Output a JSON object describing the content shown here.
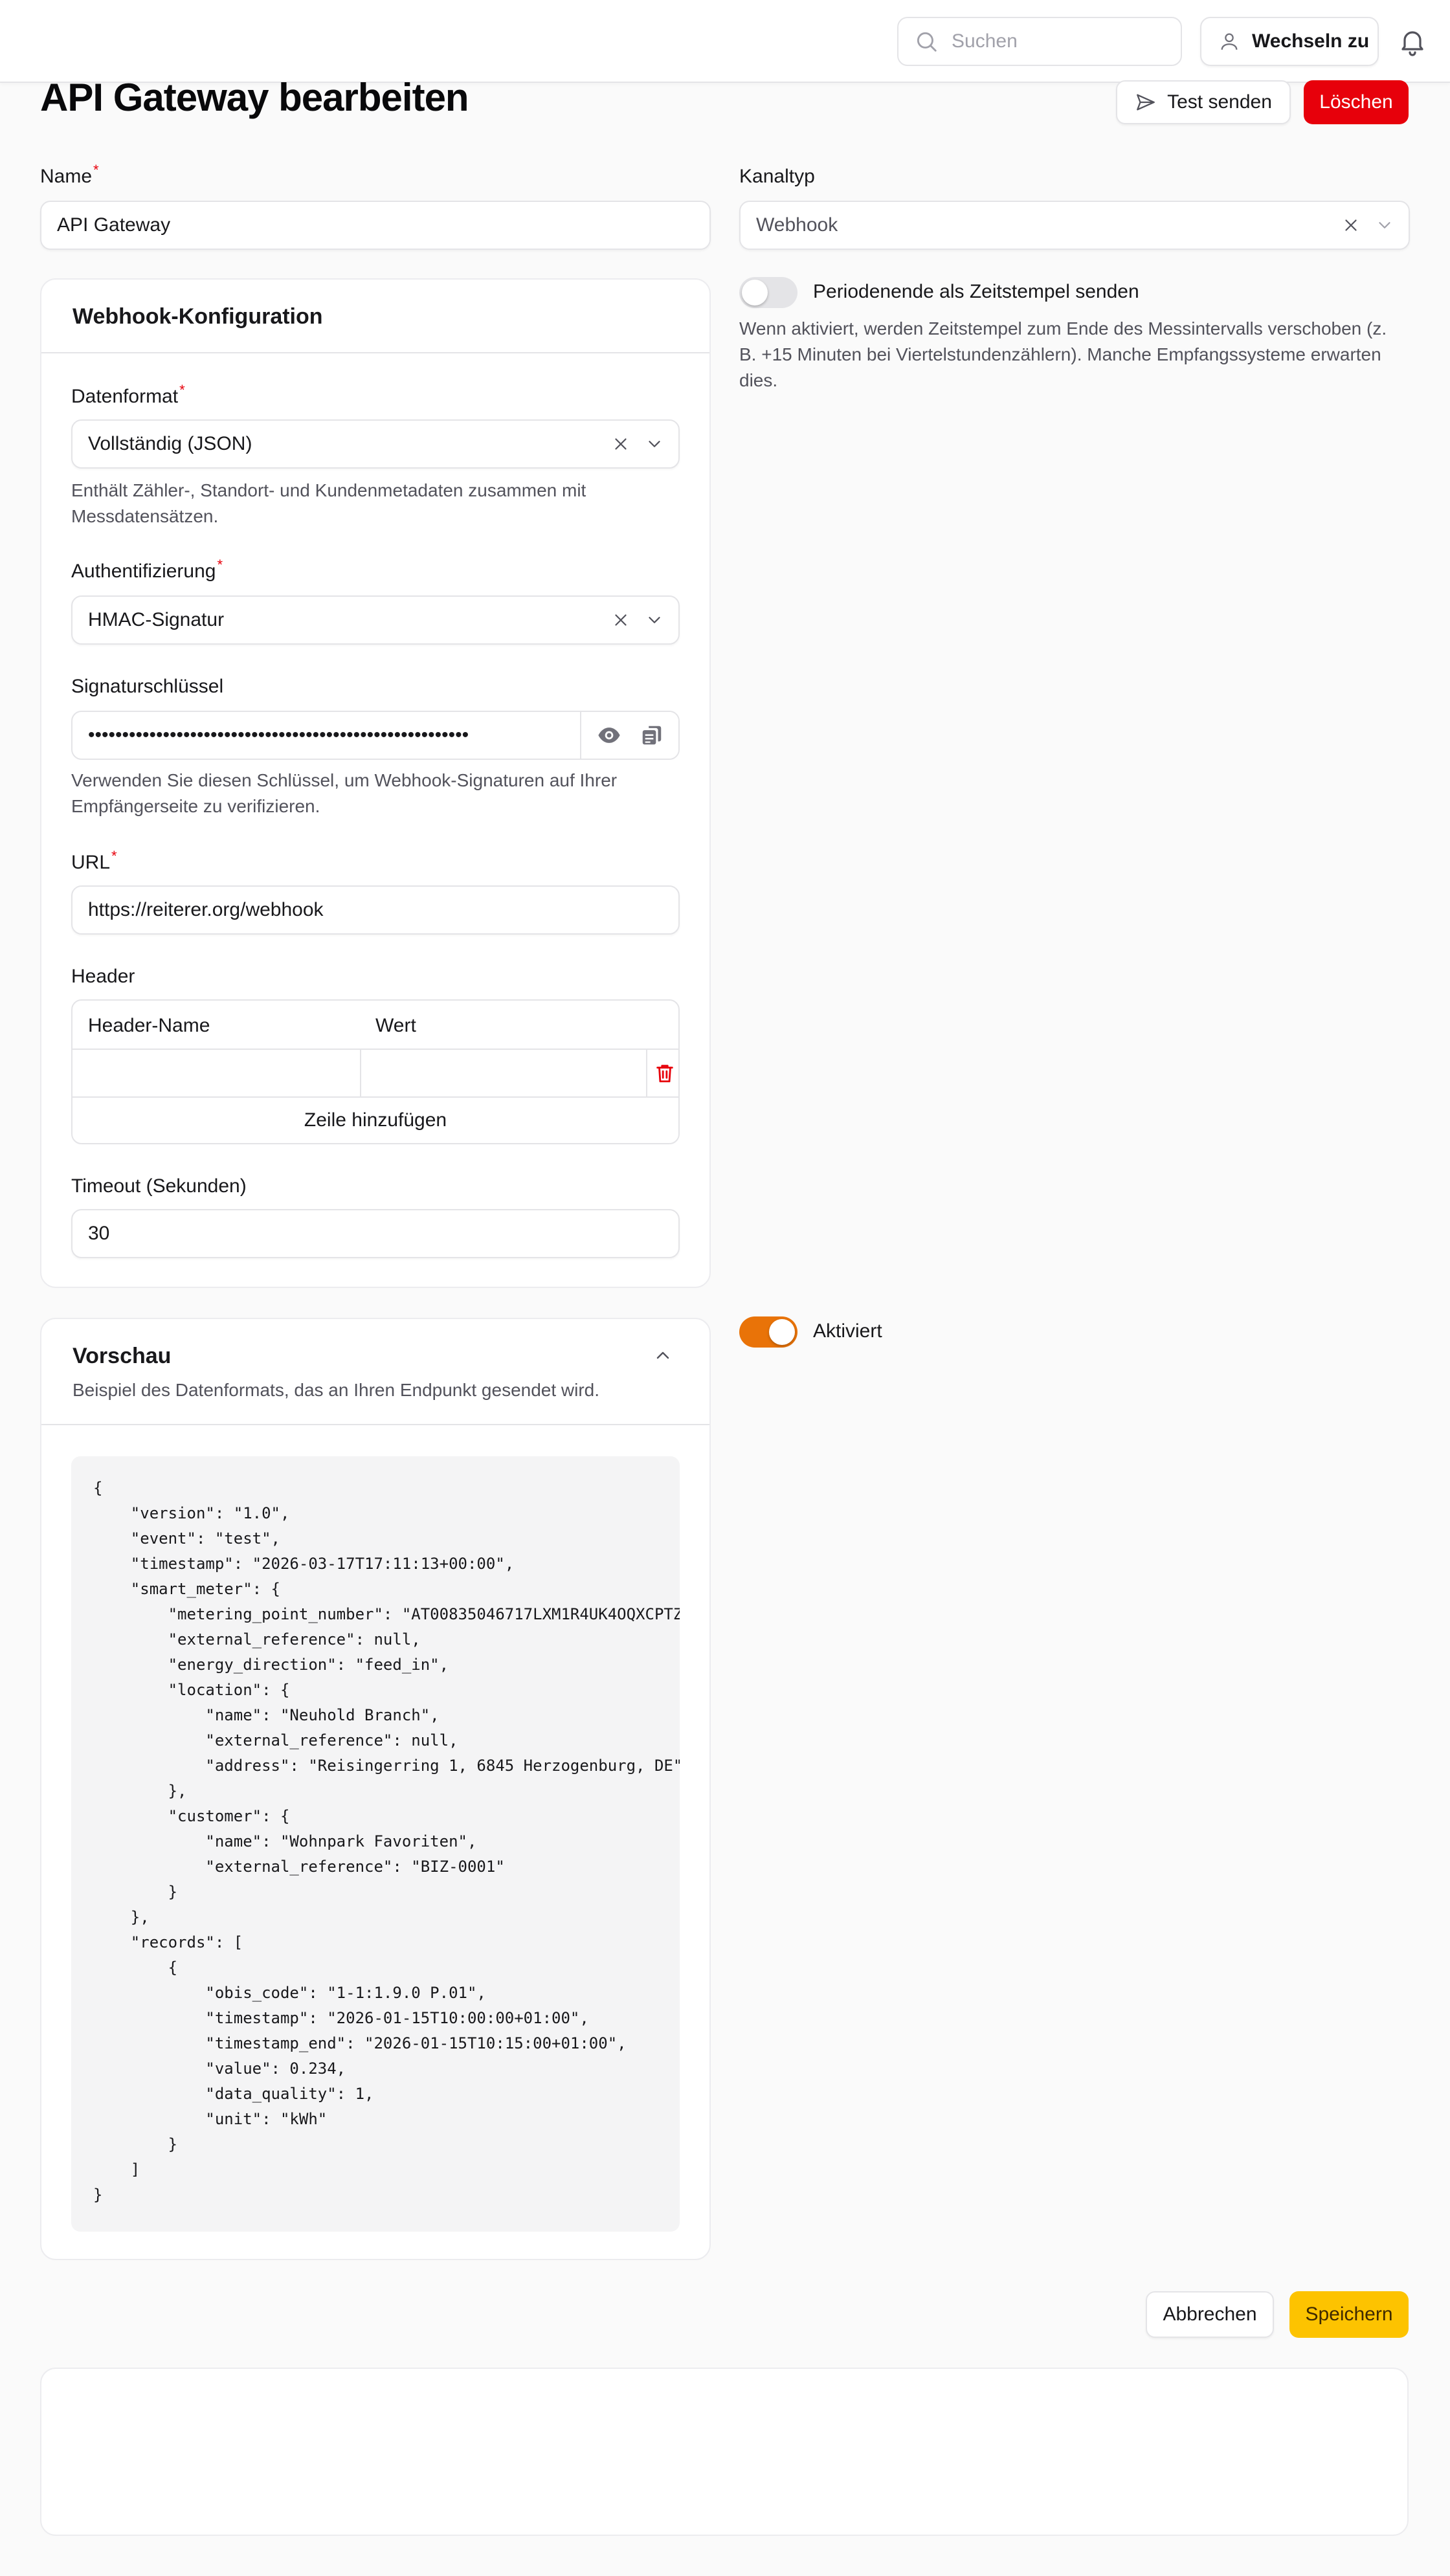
{
  "topbar": {
    "search_placeholder": "Suchen",
    "switch_label": "Wechseln zu"
  },
  "header": {
    "title": "API Gateway bearbeiten",
    "test_label": "Test senden",
    "delete_label": "Löschen"
  },
  "form": {
    "name_label": "Name",
    "name_value": "API Gateway",
    "channel_label": "Kanaltyp",
    "channel_value": "Webhook",
    "period_toggle_label": "Periodenende als Zeitstempel senden",
    "period_toggle_on": false,
    "period_help": "Wenn aktiviert, werden Zeitstempel zum Ende des Messintervalls verschoben (z. B. +15 Minuten bei Viertelstundenzählern). Manche Empfangssysteme erwarten dies.",
    "enabled_label": "Aktiviert",
    "enabled_on": true
  },
  "webhook": {
    "title": "Webhook-Konfiguration",
    "format_label": "Datenformat",
    "format_value": "Vollständig (JSON)",
    "format_help": "Enthält Zähler-, Standort- und Kundenmetadaten zusammen mit Messdatensätzen.",
    "auth_label": "Authentifizierung",
    "auth_value": "HMAC-Signatur",
    "secret_label": "Signaturschlüssel",
    "secret_value": "••••••••••••••••••••••••••••••••••••••••••••••••••••••••",
    "secret_help": "Verwenden Sie diesen Schlüssel, um Webhook-Signaturen auf Ihrer Empfängerseite zu verifizieren.",
    "url_label": "URL",
    "url_value": "https://reiterer.org/webhook",
    "headers_label": "Header",
    "headers_col_name": "Header-Name",
    "headers_col_value": "Wert",
    "add_row_label": "Zeile hinzufügen",
    "timeout_label": "Timeout (Sekunden)",
    "timeout_value": "30"
  },
  "preview": {
    "title": "Vorschau",
    "subtitle": "Beispiel des Datenformats, das an Ihren Endpunkt gesendet wird.",
    "code": "{\n    \"version\": \"1.0\",\n    \"event\": \"test\",\n    \"timestamp\": \"2026-03-17T17:11:13+00:00\",\n    \"smart_meter\": {\n        \"metering_point_number\": \"AT00835046717LXM1R4UK4OQXCPTZ\n        \"external_reference\": null,\n        \"energy_direction\": \"feed_in\",\n        \"location\": {\n            \"name\": \"Neuhold Branch\",\n            \"external_reference\": null,\n            \"address\": \"Reisingerring 1, 6845 Herzogenburg, DE\"\n        },\n        \"customer\": {\n            \"name\": \"Wohnpark Favoriten\",\n            \"external_reference\": \"BIZ-0001\"\n        }\n    },\n    \"records\": [\n        {\n            \"obis_code\": \"1-1:1.9.0 P.01\",\n            \"timestamp\": \"2026-01-15T10:00:00+01:00\",\n            \"timestamp_end\": \"2026-01-15T10:15:00+01:00\",\n            \"value\": 0.234,\n            \"data_quality\": 1,\n            \"unit\": \"kWh\"\n        }\n    ]\n}"
  },
  "footer": {
    "cancel_label": "Abbrechen",
    "save_label": "Speichern"
  },
  "colors": {
    "danger": "#e7000b",
    "accent_orange": "#e97308",
    "save_yellow": "#fdc300"
  }
}
